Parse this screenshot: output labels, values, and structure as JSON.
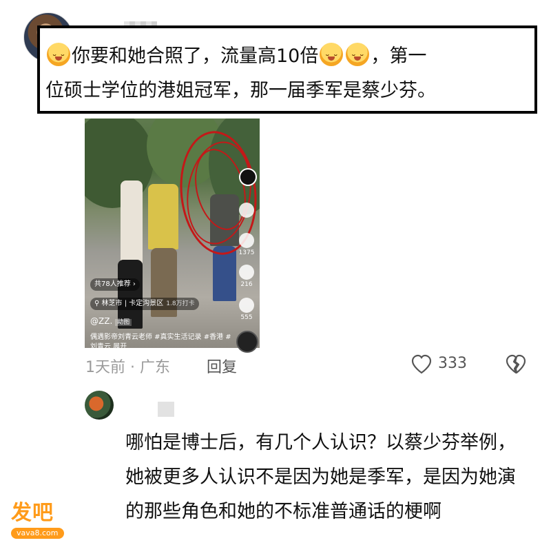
{
  "comment_1": {
    "text_line1_a": "你要和她合照了，流量高10倍",
    "text_line1_b": "，第一",
    "text_line2": "位硕士学位的港姐冠军，那一届季军是蔡少芬。",
    "emoji": "smirk-face-emoji",
    "meta_time": "1天前 · 广东",
    "reply_label": "回复",
    "like_count": "333"
  },
  "video": {
    "recommend_pill": "共78人推荐 ›",
    "location_label": "林芝市 | 卡定沟景区",
    "location_sub": "1.8万打卡",
    "author": "@ZZ.",
    "author_tag": "动图",
    "caption": "偶遇影帝刘青云老师 #真实生活记录 #香港 #刘青云  展开",
    "like_side": "",
    "comment_side": "1375",
    "star_side": "216",
    "share_side": "555"
  },
  "comment_2": {
    "text": "哪怕是博士后，有几个人认识？以蔡少芬举例，她被更多人认识不是因为她是季军，是因为她演的那些角色和她的不标准普通话的梗啊"
  },
  "watermark": {
    "main": "发吧",
    "sub": "vava8.com"
  },
  "colors": {
    "accent_orange": "#ff9b1a",
    "annotation_red": "#c41818",
    "meta_gray": "#9a9a9a"
  }
}
